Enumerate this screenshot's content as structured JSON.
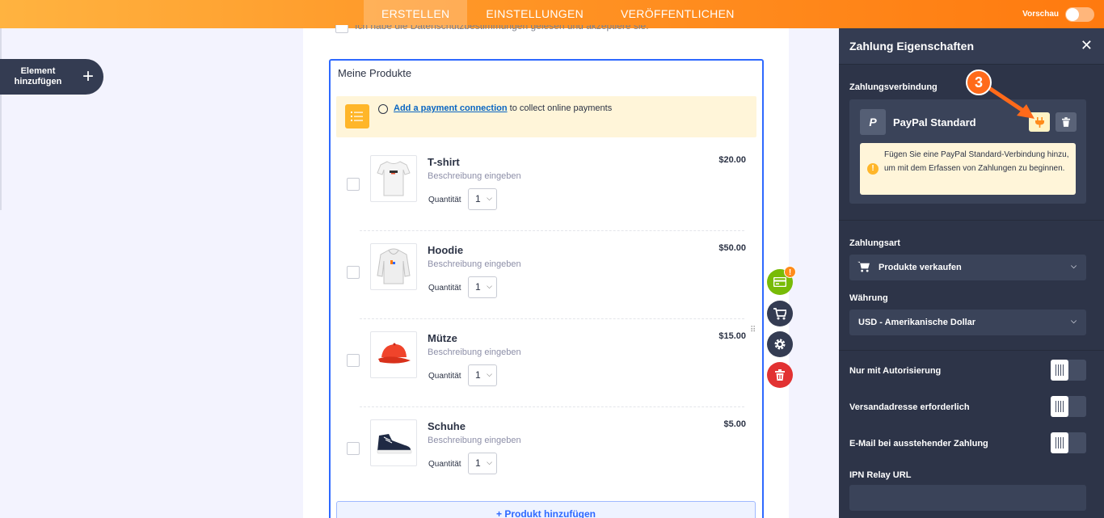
{
  "topbar": {
    "tabs": [
      {
        "label": "ERSTELLEN",
        "active": true
      },
      {
        "label": "EINSTELLUNGEN",
        "active": false
      },
      {
        "label": "VERÖFFENTLICHEN",
        "active": false
      }
    ],
    "preview_label": "Vorschau",
    "preview_on": false,
    "accent_color": "#ff8a1f"
  },
  "left": {
    "add_element_label": "Element hinzufügen",
    "add_icon": "plus-icon"
  },
  "form": {
    "top_checkbox_label": "Ich habe die Datenschutzbestimmungen gelesen und akzeptiere sie.",
    "products_title": "Meine Produkte",
    "notice": {
      "icon": "list-icon",
      "link_text": "Add a payment connection",
      "rest_text": " to collect online payments"
    },
    "quantity_label": "Quantität",
    "products": [
      {
        "name": "T-shirt",
        "description": "Beschreibung eingeben",
        "price": "$20.00",
        "quantity": "1",
        "image": "tshirt-image"
      },
      {
        "name": "Hoodie",
        "description": "Beschreibung eingeben",
        "price": "$50.00",
        "quantity": "1",
        "image": "hoodie-image"
      },
      {
        "name": "Mütze",
        "description": "Beschreibung eingeben",
        "price": "$15.00",
        "quantity": "1",
        "image": "cap-image"
      },
      {
        "name": "Schuhe",
        "description": "Beschreibung eingeben",
        "price": "$5.00",
        "quantity": "1",
        "image": "shoe-image"
      }
    ],
    "add_product_label": "+ Produkt hinzufügen"
  },
  "tools": [
    {
      "name": "payment-tool",
      "icon": "card-icon",
      "color": "#78bb07",
      "badge": "!"
    },
    {
      "name": "cart-tool",
      "icon": "cart-icon",
      "color": "#343c52"
    },
    {
      "name": "settings-tool",
      "icon": "gear-icon",
      "color": "#343c52"
    },
    {
      "name": "delete-tool",
      "icon": "trash-icon",
      "color": "#e23232"
    }
  ],
  "panel": {
    "title": "Zahlung Eigenschaften",
    "connection_label": "Zahlungsverbindung",
    "provider_name": "PayPal Standard",
    "provider_logo_letter": "P",
    "warning_text": "Fügen Sie eine PayPal Standard-Verbindung hinzu, um mit dem Erfassen von Zahlungen zu beginnen.",
    "payment_type_label": "Zahlungsart",
    "payment_type_value": "Produkte verkaufen",
    "currency_label": "Währung",
    "currency_value": "USD - Amerikanische Dollar",
    "toggles": [
      {
        "label": "Nur mit Autorisierung",
        "on": false
      },
      {
        "label": "Versandadresse erforderlich",
        "on": false
      },
      {
        "label": "E-Mail bei ausstehender Zahlung",
        "on": false
      }
    ],
    "ipn_label": "IPN Relay URL",
    "ipn_value": ""
  },
  "annotation": {
    "step_number": "3",
    "color": "#ff6a1a"
  }
}
